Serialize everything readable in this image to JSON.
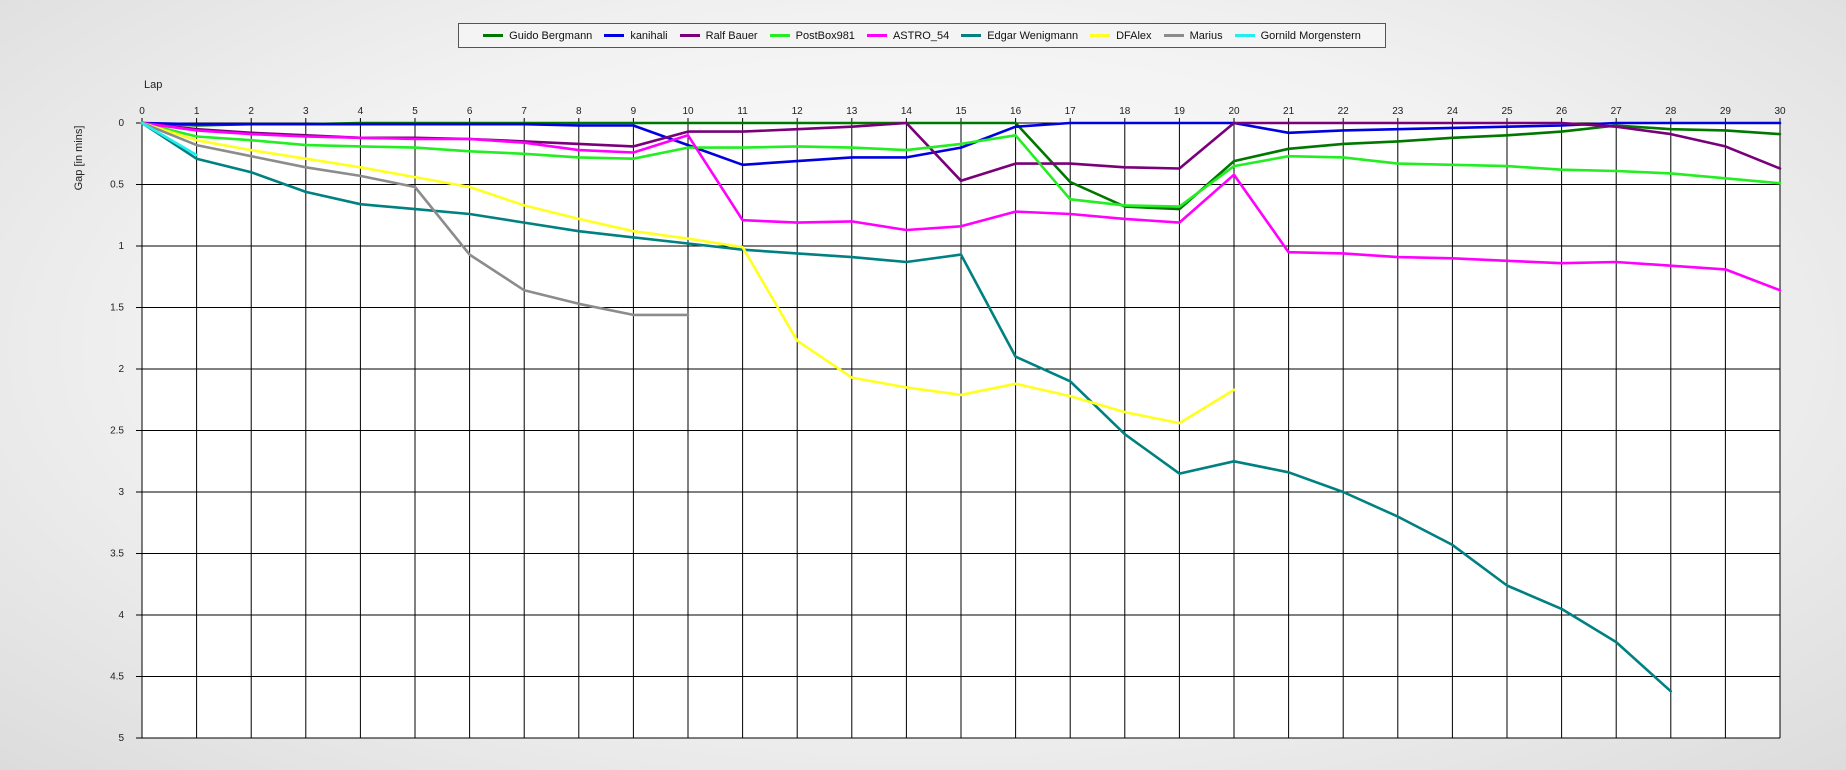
{
  "chart_data": {
    "type": "line",
    "title": "",
    "xlabel": "Lap",
    "ylabel": "Gap [in mins]",
    "xlim": [
      0,
      30
    ],
    "ylim": [
      0,
      5
    ],
    "y_inverted": true,
    "grid": true,
    "legend_position": "top-center",
    "x_ticks": [
      0,
      1,
      2,
      3,
      4,
      5,
      6,
      7,
      8,
      9,
      10,
      11,
      12,
      13,
      14,
      15,
      16,
      17,
      18,
      19,
      20,
      21,
      22,
      23,
      24,
      25,
      26,
      27,
      28,
      29,
      30
    ],
    "y_ticks": [
      0,
      0.5,
      1,
      1.5,
      2,
      2.5,
      3,
      3.5,
      4,
      4.5,
      5
    ],
    "y_tick_labels": [
      "0",
      "0.5",
      "1",
      "1.5",
      "2",
      "2.5",
      "3",
      "3.5",
      "4",
      "4.5",
      "5"
    ],
    "series": [
      {
        "name": "Guido Bergmann",
        "color": "#007800",
        "x": [
          0,
          1,
          2,
          3,
          4,
          5,
          6,
          7,
          8,
          9,
          10,
          11,
          12,
          13,
          14,
          15,
          16,
          17,
          18,
          19,
          20,
          21,
          22,
          23,
          24,
          25,
          26,
          27,
          28,
          29,
          30
        ],
        "values": [
          0,
          0.02,
          0.01,
          0.01,
          0,
          0,
          0,
          0,
          0,
          0,
          0,
          0,
          0,
          0,
          0,
          0,
          0,
          0.48,
          0.68,
          0.7,
          0.31,
          0.21,
          0.17,
          0.15,
          0.12,
          0.1,
          0.07,
          0.02,
          0.05,
          0.06,
          0.09
        ]
      },
      {
        "name": "kanihali",
        "color": "#0000e0",
        "x": [
          0,
          1,
          2,
          3,
          4,
          5,
          6,
          7,
          8,
          9,
          10,
          11,
          12,
          13,
          14,
          15,
          16,
          17,
          18,
          19,
          20,
          21,
          22,
          23,
          24,
          25,
          26,
          27,
          28,
          29,
          30
        ],
        "values": [
          0,
          0.01,
          0.01,
          0.01,
          0.01,
          0.01,
          0.01,
          0.01,
          0.02,
          0.02,
          0.18,
          0.34,
          0.31,
          0.28,
          0.28,
          0.2,
          0.03,
          0,
          0,
          0,
          0,
          0.08,
          0.06,
          0.05,
          0.04,
          0.03,
          0.02,
          0,
          0,
          0,
          0
        ]
      },
      {
        "name": "Ralf Bauer",
        "color": "#7a007a",
        "x": [
          0,
          1,
          2,
          3,
          4,
          5,
          6,
          7,
          8,
          9,
          10,
          11,
          12,
          13,
          14,
          15,
          16,
          17,
          18,
          19,
          20,
          21,
          22,
          23,
          24,
          25,
          26,
          27,
          28,
          29,
          30
        ],
        "values": [
          0,
          0.05,
          0.08,
          0.1,
          0.12,
          0.12,
          0.13,
          0.15,
          0.17,
          0.19,
          0.07,
          0.07,
          0.05,
          0.03,
          0,
          0.47,
          0.33,
          0.33,
          0.36,
          0.37,
          0,
          0,
          0,
          0,
          0,
          0,
          0,
          0.03,
          0.09,
          0.19,
          0.37
        ]
      },
      {
        "name": "PostBox981",
        "color": "#22ee22",
        "x": [
          0,
          1,
          2,
          3,
          4,
          5,
          6,
          7,
          8,
          9,
          10,
          11,
          12,
          13,
          14,
          15,
          16,
          17,
          18,
          19,
          20,
          21,
          22,
          23,
          24,
          25,
          26,
          27,
          28,
          29,
          30
        ],
        "values": [
          0,
          0.11,
          0.14,
          0.18,
          0.19,
          0.2,
          0.23,
          0.25,
          0.28,
          0.29,
          0.2,
          0.2,
          0.19,
          0.2,
          0.22,
          0.17,
          0.1,
          0.62,
          0.67,
          0.68,
          0.35,
          0.27,
          0.28,
          0.33,
          0.34,
          0.35,
          0.38,
          0.39,
          0.41,
          0.45,
          0.49
        ]
      },
      {
        "name": "ASTRO_54",
        "color": "#ff00ff",
        "x": [
          0,
          1,
          2,
          3,
          4,
          5,
          6,
          7,
          8,
          9,
          10,
          11,
          12,
          13,
          14,
          15,
          16,
          17,
          18,
          19,
          20,
          21,
          22,
          23,
          24,
          25,
          26,
          27,
          28,
          29,
          30
        ],
        "values": [
          0,
          0.06,
          0.09,
          0.11,
          0.12,
          0.13,
          0.13,
          0.16,
          0.22,
          0.24,
          0.1,
          0.79,
          0.81,
          0.8,
          0.87,
          0.84,
          0.72,
          0.74,
          0.78,
          0.81,
          0.42,
          1.05,
          1.06,
          1.09,
          1.1,
          1.12,
          1.14,
          1.13,
          1.16,
          1.19,
          1.36
        ]
      },
      {
        "name": "Edgar Wenigmann",
        "color": "#008080",
        "x": [
          0,
          1,
          2,
          3,
          4,
          5,
          6,
          7,
          8,
          9,
          10,
          11,
          12,
          13,
          14,
          15,
          16,
          17,
          18,
          19,
          20,
          21,
          22,
          23,
          24,
          25,
          26,
          27,
          28
        ],
        "values": [
          0,
          0.29,
          0.4,
          0.56,
          0.66,
          0.7,
          0.74,
          0.81,
          0.88,
          0.93,
          0.98,
          1.03,
          1.06,
          1.09,
          1.13,
          1.07,
          1.9,
          2.1,
          2.53,
          2.85,
          2.75,
          2.84,
          3.0,
          3.2,
          3.43,
          3.76,
          3.95,
          4.22,
          4.62
        ]
      },
      {
        "name": "DFAlex",
        "color": "#ffff22",
        "x": [
          0,
          1,
          2,
          3,
          4,
          5,
          6,
          7,
          8,
          9,
          10,
          11,
          12,
          13,
          14,
          15,
          16,
          17,
          18,
          19,
          20
        ],
        "values": [
          0,
          0.14,
          0.22,
          0.29,
          0.36,
          0.44,
          0.52,
          0.67,
          0.78,
          0.88,
          0.94,
          1.01,
          1.77,
          2.07,
          2.15,
          2.21,
          2.12,
          2.22,
          2.35,
          2.44,
          2.17
        ]
      },
      {
        "name": "Marius",
        "color": "#8c8c8c",
        "x": [
          0,
          1,
          2,
          3,
          4,
          5,
          6,
          7,
          8,
          9,
          10
        ],
        "values": [
          0,
          0.18,
          0.27,
          0.36,
          0.43,
          0.52,
          1.07,
          1.36,
          1.47,
          1.56,
          1.56
        ]
      },
      {
        "name": "Gornild Morgenstern",
        "color": "#22eeee",
        "x": [
          0,
          1
        ],
        "values": [
          0,
          0.26
        ]
      }
    ]
  }
}
